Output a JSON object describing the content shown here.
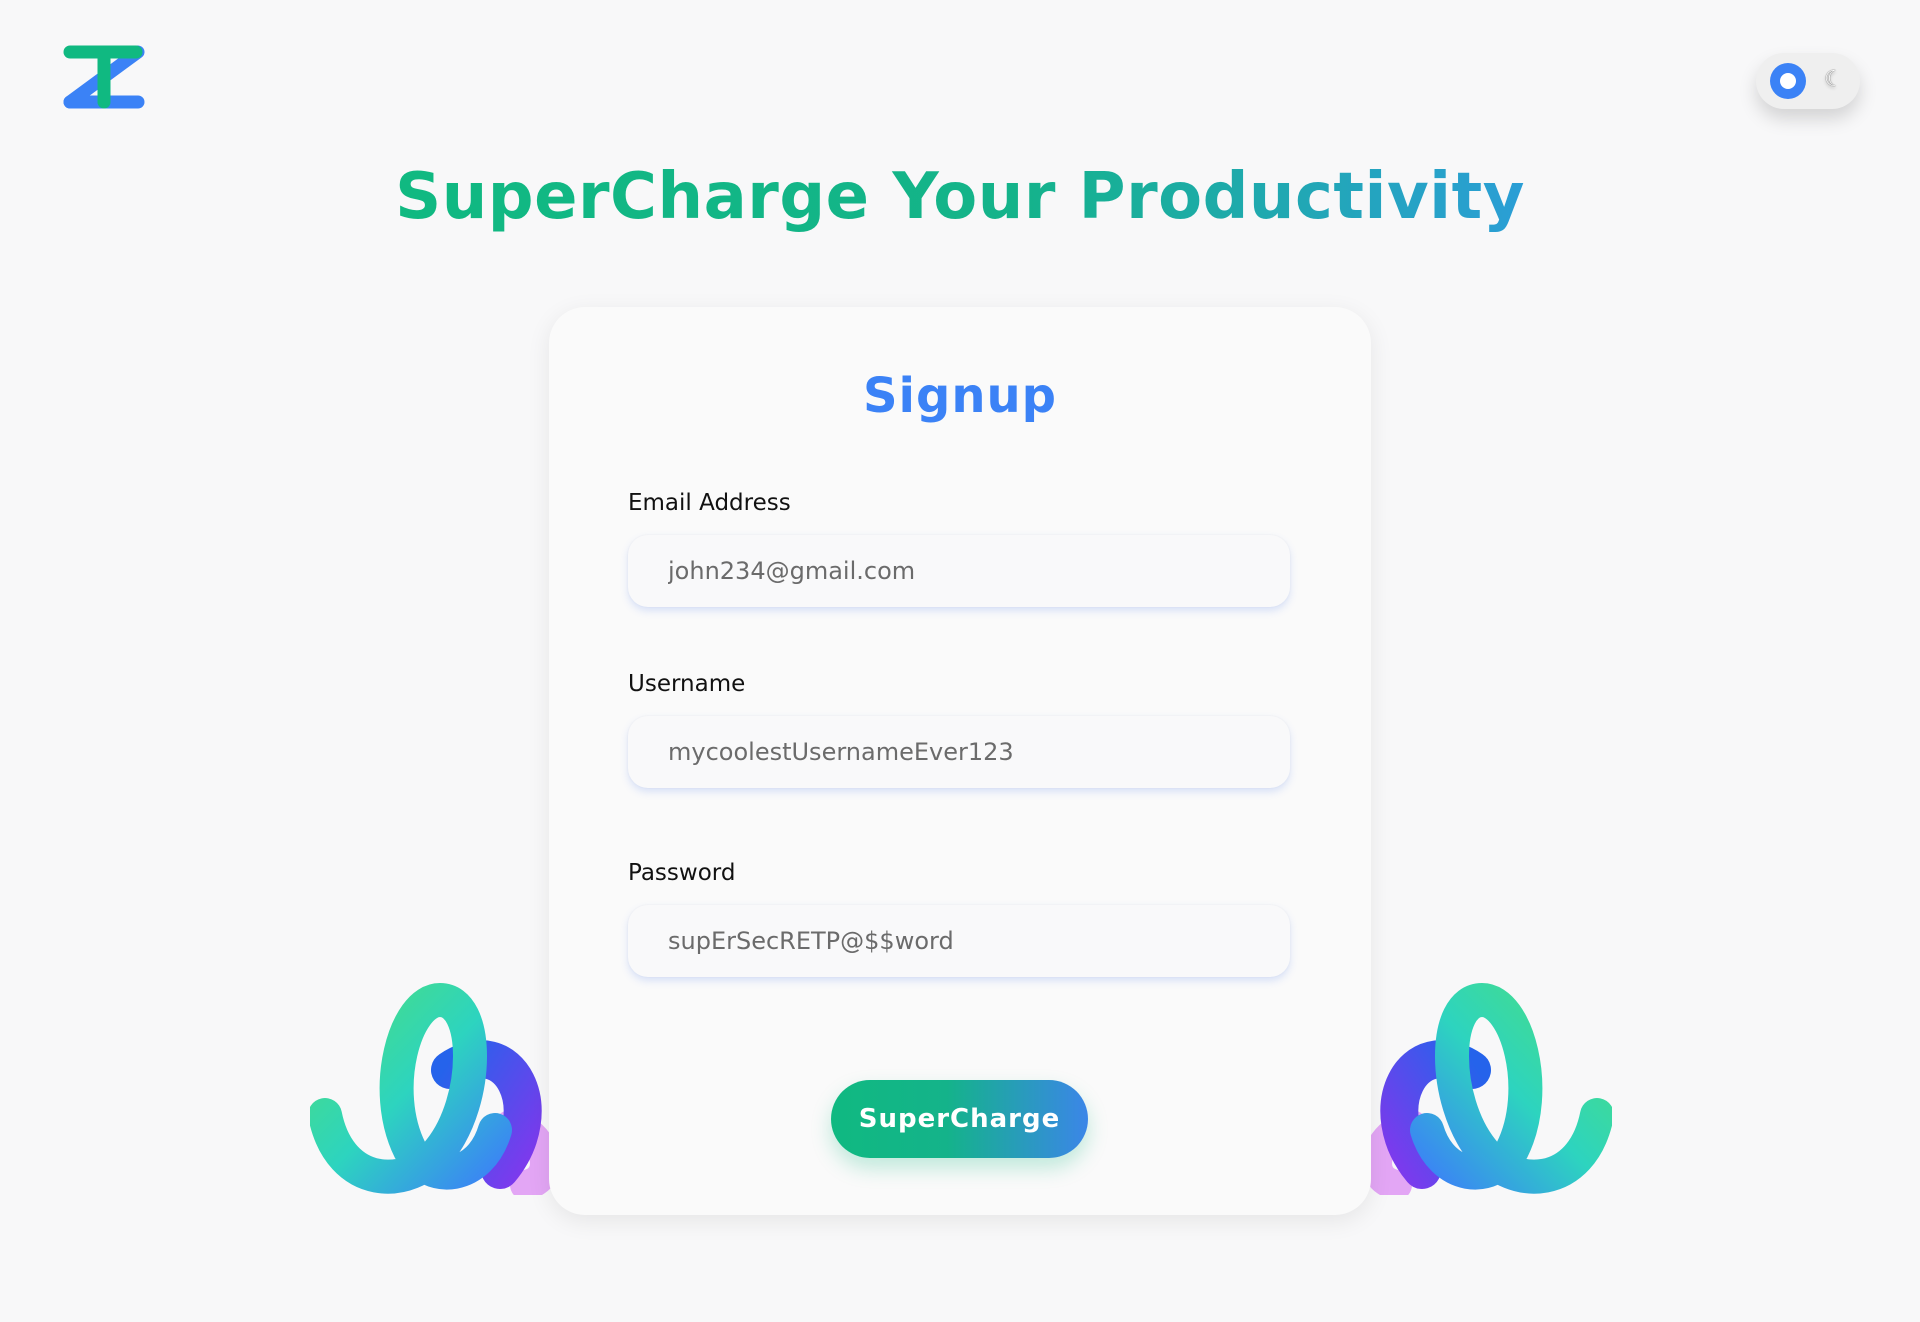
{
  "logo_alt": "TZ",
  "theme_toggle": {
    "state": "light"
  },
  "hero": {
    "title": "SuperCharge Your Productivity"
  },
  "signup": {
    "title": "Signup",
    "email": {
      "label": "Email Address",
      "value": "john234@gmail.com"
    },
    "username": {
      "label": "Username",
      "value": "mycoolestUsernameEver123"
    },
    "password": {
      "label": "Password",
      "value": "supErSecRETP@$$word"
    },
    "submit_label": "SuperCharge"
  },
  "colors": {
    "primary_blue": "#3b82f6",
    "primary_green": "#10b981"
  }
}
